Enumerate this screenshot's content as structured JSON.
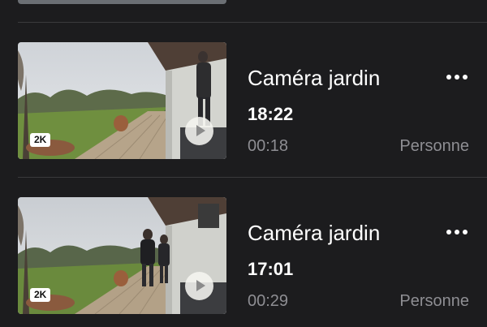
{
  "events": [
    {
      "camera": "Caméra jardin",
      "time": "18:22",
      "duration": "00:18",
      "detection": "Personne",
      "resolution_badge": "2K",
      "thumbnail_icon": "play-icon"
    },
    {
      "camera": "Caméra jardin",
      "time": "17:01",
      "duration": "00:29",
      "detection": "Personne",
      "resolution_badge": "2K",
      "thumbnail_icon": "play-icon"
    }
  ],
  "colors": {
    "background": "#1c1c1e",
    "divider": "#3a3a3c",
    "secondary_text": "#8e8e93",
    "primary_text": "#ffffff"
  },
  "icons": {
    "more": "more-horizontal-icon",
    "play": "play-icon"
  }
}
